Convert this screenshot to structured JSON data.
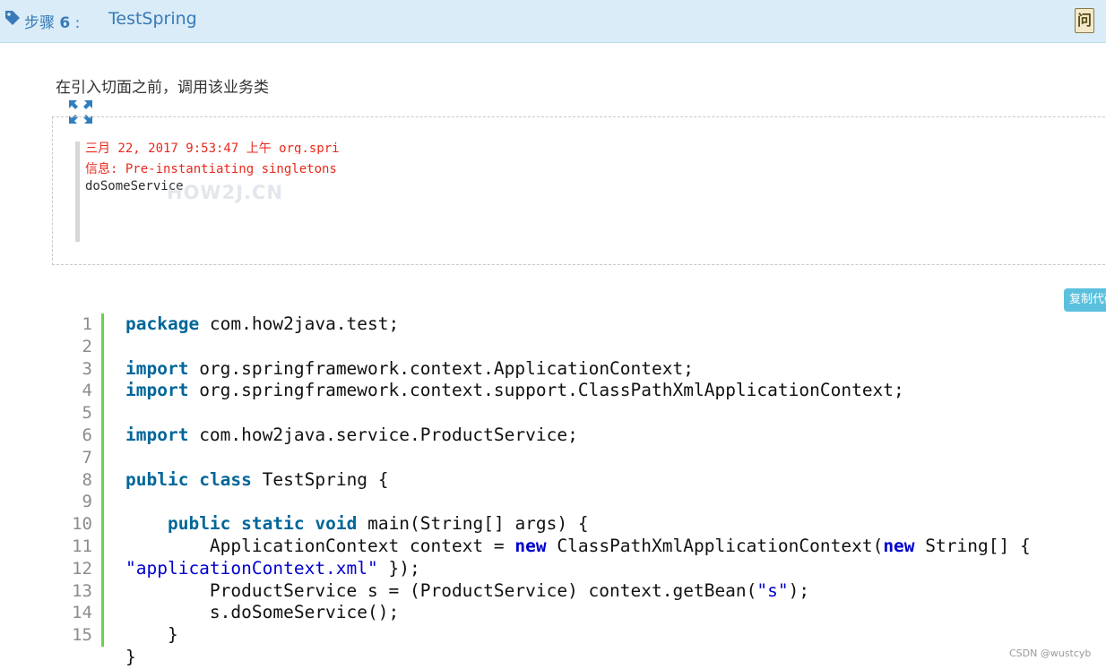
{
  "step": {
    "label_prefix": "步骤",
    "number": "6",
    "separator": ":",
    "title": "TestSpring",
    "ask_label": "问"
  },
  "description": "在引入切面之前，调用该业务类",
  "console": {
    "lines": [
      "三月 22, 2017 9:53:47 上午 org.spri",
      "信息: Pre-instantiating singletons",
      "doSomeService"
    ],
    "watermark": "HOW2J.CN"
  },
  "copy_label": "复制代码",
  "code": {
    "line_numbers": [
      "1",
      "2",
      "3",
      "4",
      "5",
      "6",
      "7",
      "8",
      "9",
      "10",
      "11",
      "12",
      "13",
      "14",
      "15"
    ],
    "lines": [
      "package com.how2java.test;",
      "",
      "import org.springframework.context.ApplicationContext;",
      "import org.springframework.context.support.ClassPathXmlApplicationContext;",
      "",
      "import com.how2java.service.ProductService;",
      "",
      "public class TestSpring {",
      "",
      "    public static void main(String[] args) {",
      "        ApplicationContext context = new ClassPathXmlApplicationContext(new String[] {",
      "\"applicationContext.xml\" });",
      "        ProductService s = (ProductService) context.getBean(\"s\");",
      "        s.doSomeService();",
      "    }",
      "}"
    ]
  },
  "footer": "CSDN @wustcyb",
  "colors": {
    "header_bg": "#d9ecf7",
    "accent_blue": "#3a7ab8",
    "keyword": "#006699",
    "gutter_green": "#6fce4f",
    "copy_button": "#5bc0de"
  }
}
